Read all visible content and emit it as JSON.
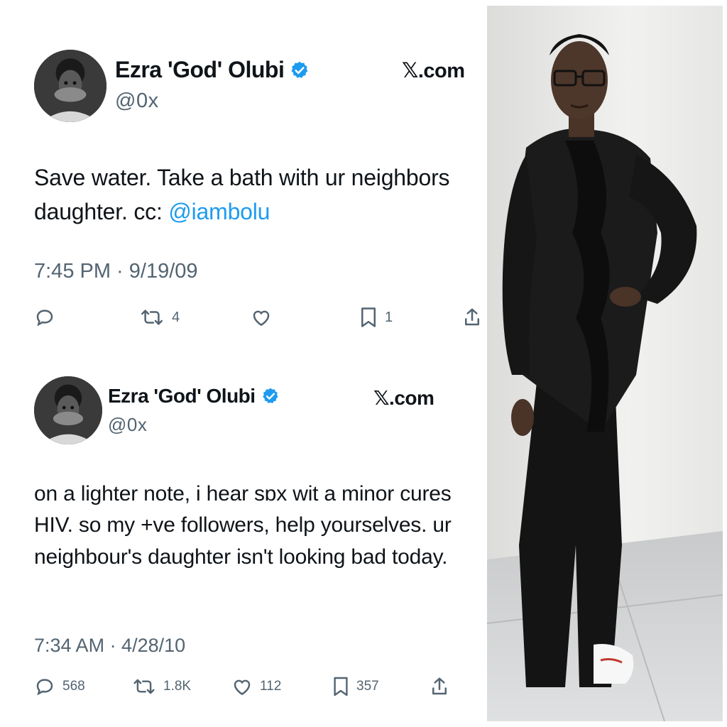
{
  "tweets": [
    {
      "author": "Ezra 'God' Olubi",
      "handle": "@0x",
      "site": "𝕏.com",
      "text_before": "Save water. Take a bath with ur neighbors daughter. cc: ",
      "mention": "@iambolu",
      "timestamp": "7:45 PM · 9/19/09",
      "counts": {
        "reply": "",
        "retweet": "4",
        "like": "",
        "bookmark": "1"
      },
      "icons": [
        "reply-icon",
        "retweet-icon",
        "like-icon",
        "bookmark-icon",
        "share-icon"
      ]
    },
    {
      "author": "Ezra 'God' Olubi",
      "handle": "@0x",
      "site": "𝕏.com",
      "text": "on a lighter note, i hear sɒx wit a minor cures HIV. so my +ve followers, help yourselves. ur neighbour's daughter isn't looking bad today.",
      "timestamp": "7:34 AM · 4/28/10",
      "counts": {
        "reply": "568",
        "retweet": "1.8K",
        "like": "112",
        "bookmark": "357"
      },
      "icons": [
        "reply-icon",
        "retweet-icon",
        "like-icon",
        "bookmark-icon",
        "share-icon"
      ]
    }
  ],
  "colors": {
    "text": "#0f1419",
    "muted": "#536471",
    "link": "#1d9bf0",
    "verified": "#1d9bf0"
  }
}
